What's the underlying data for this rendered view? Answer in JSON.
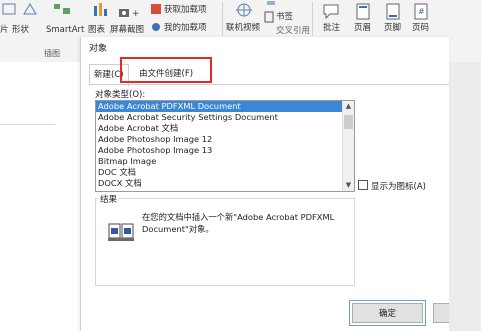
{
  "ribbon": {
    "left_items": [
      "片",
      "形状",
      "SmartArt",
      "图表",
      "屏幕截图"
    ],
    "group_label": "插图",
    "addin_get": "获取加载项",
    "addin_my": "我的加载项",
    "online_video": "联机视频",
    "bookmark": "书签",
    "cross_ref": "交叉引用",
    "comment": "批注",
    "header": "页眉",
    "footer": "页脚",
    "page_number": "页码"
  },
  "dialog": {
    "title": "对象",
    "tab_new": "新建(C)",
    "tab_from_file": "由文件创建(F)",
    "object_type_label": "对象类型(O):",
    "object_types": [
      "Adobe Acrobat PDFXML Document",
      "Adobe Acrobat Security Settings Document",
      "Adobe Acrobat 文档",
      "Adobe Photoshop Image 12",
      "Adobe Photoshop Image 13",
      "Bitmap Image",
      "DOC 文档",
      "DOCX 文档"
    ],
    "selected_index": 0,
    "display_as_icon": "显示为图标(A)",
    "result_label": "结果",
    "result_text": "在您的文档中插入一个新\"Adobe Acrobat PDFXML Document\"对象。",
    "ok_button": "确定"
  },
  "colors": {
    "highlight": "#e32b2b",
    "selection": "#3b86d6"
  }
}
